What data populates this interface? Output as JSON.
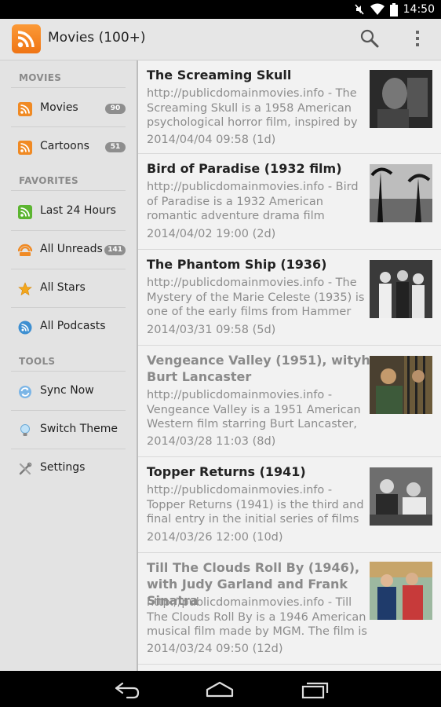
{
  "status": {
    "time": "14:50"
  },
  "app": {
    "title": "Movies (100+)"
  },
  "sidebar": {
    "sections": [
      {
        "header": "MOVIES",
        "items": [
          {
            "label": "Movies",
            "badge": "90",
            "icon": "rss-orange-icon"
          },
          {
            "label": "Cartoons",
            "badge": "51",
            "icon": "rss-orange-icon"
          }
        ]
      },
      {
        "header": "FAVORITES",
        "items": [
          {
            "label": "Last 24 Hours",
            "icon": "rss-green-icon"
          },
          {
            "label": "All Unreads",
            "badge": "141",
            "icon": "unread-icon"
          },
          {
            "label": "All Stars",
            "icon": "star-icon"
          },
          {
            "label": "All Podcasts",
            "icon": "podcast-icon"
          }
        ]
      },
      {
        "header": "TOOLS",
        "items": [
          {
            "label": "Sync Now",
            "icon": "sync-icon"
          },
          {
            "label": "Switch Theme",
            "icon": "lightbulb-icon"
          },
          {
            "label": "Settings",
            "icon": "tools-icon"
          }
        ]
      }
    ]
  },
  "articles": [
    {
      "title": "The Screaming Skull",
      "snippet": "http://publicdomainmovies.info - The Screaming Skull is a 1958 American psychological horror film, inspired by",
      "date": "2014/04/04 09:58 (1d)",
      "read": false
    },
    {
      "title": "Bird of Paradise (1932 film)",
      "snippet": "http://publicdomainmovies.info - Bird of Paradise is a 1932 American romantic adventure drama film",
      "date": "2014/04/02 19:00 (2d)",
      "read": false
    },
    {
      "title": "The Phantom Ship (1936)",
      "snippet": "http://publicdomainmovies.info - The Mystery of the Marie Celeste (1935) is one of the early films from Hammer",
      "date": "2014/03/31 09:58 (5d)",
      "read": false
    },
    {
      "title": "Vengeance Valley (1951), wityh Burt Lancaster",
      "snippet": "http://publicdomainmovies.info - Vengeance Valley is a 1951 American Western film starring Burt Lancaster,",
      "date": "2014/03/28 11:03 (8d)",
      "read": true
    },
    {
      "title": "Topper Returns (1941)",
      "snippet": "http://publicdomainmovies.info - Topper Returns (1941) is the third and final entry in the initial series of films",
      "date": "2014/03/26 12:00 (10d)",
      "read": false
    },
    {
      "title": "Till The Clouds Roll By (1946), with Judy Garland and Frank Sinatra",
      "snippet": "http://publicdomainmovies.info - Till The Clouds Roll By is a 1946 American musical film made by MGM. The film is",
      "date": "2014/03/24 09:50 (12d)",
      "read": true
    }
  ]
}
